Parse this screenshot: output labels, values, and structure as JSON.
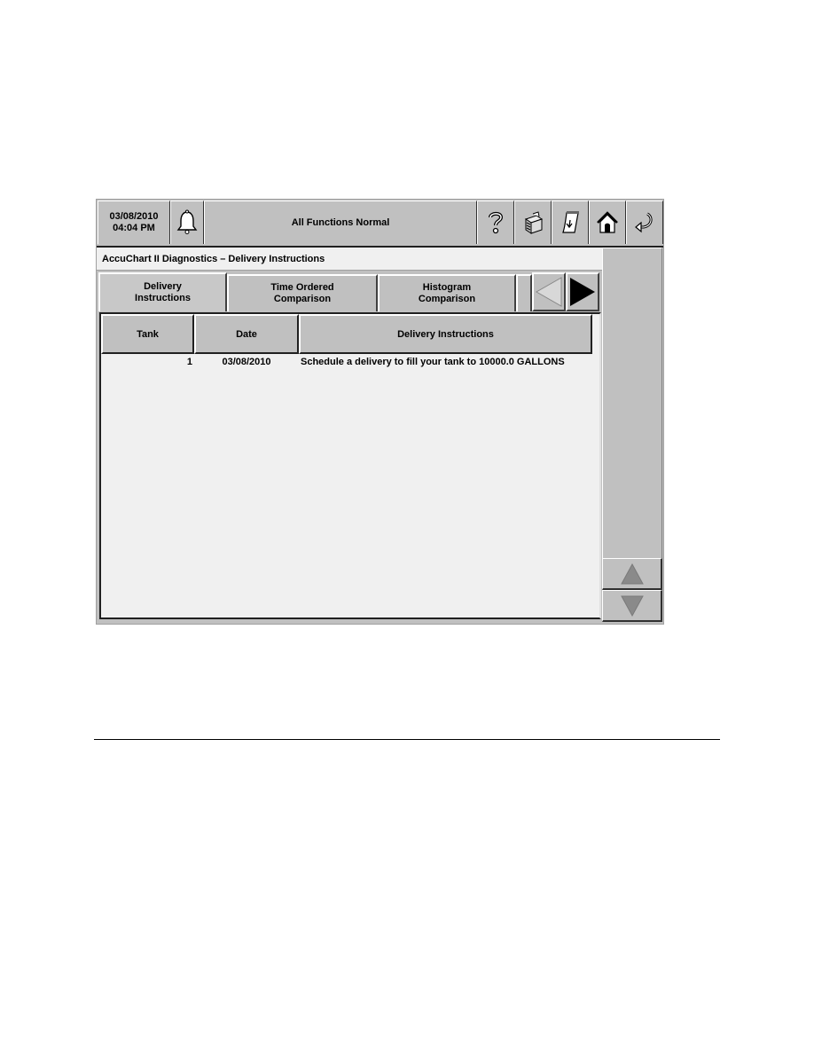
{
  "topbar": {
    "date": "03/08/2010",
    "time": "04:04 PM",
    "status": "All Functions Normal",
    "icons": [
      "bell-icon",
      "help-icon",
      "printer-icon",
      "report-icon",
      "home-icon",
      "back-icon"
    ]
  },
  "title": "AccuChart II Diagnostics  –  Delivery Instructions",
  "tabs": [
    {
      "line1": "Delivery",
      "line2": "Instructions",
      "active": true
    },
    {
      "line1": "Time Ordered",
      "line2": "Comparison",
      "active": false
    },
    {
      "line1": "Histogram",
      "line2": "Comparison",
      "active": false
    }
  ],
  "table": {
    "columns": [
      "Tank",
      "Date",
      "Delivery Instructions"
    ],
    "rows": [
      {
        "tank": "1",
        "date": "03/08/2010",
        "instruction": "Schedule a delivery to fill your tank to 10000.0 GALLONS"
      }
    ]
  },
  "nav": {
    "prev_tab": "left-arrow-icon",
    "next_tab": "right-arrow-icon",
    "scroll_up": "up-arrow-icon",
    "scroll_down": "down-arrow-icon"
  }
}
